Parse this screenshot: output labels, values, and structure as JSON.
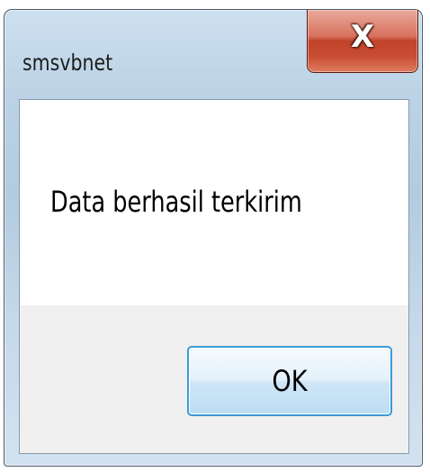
{
  "window": {
    "title": "smsvbnet",
    "close_icon": "close-icon",
    "close_glyph": "X"
  },
  "dialog": {
    "message": "Data berhasil terkirim",
    "ok_label": "OK"
  },
  "colors": {
    "close_button": "#c94d33",
    "ok_button_border": "#3c9ad8",
    "frame": "#b2cbe0"
  }
}
